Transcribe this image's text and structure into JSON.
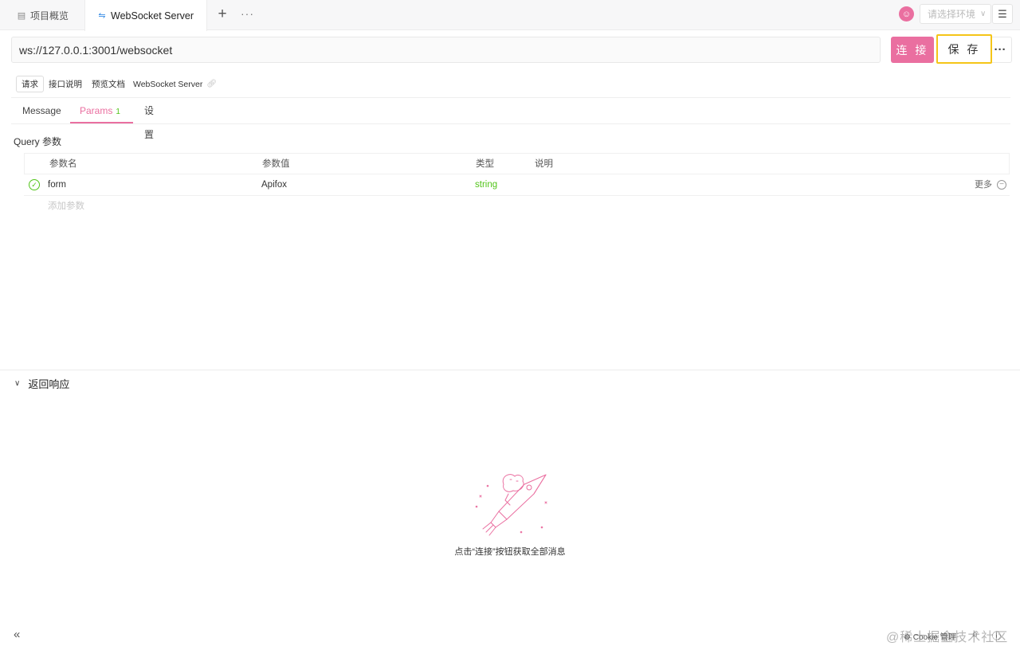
{
  "tabs": {
    "project_overview": "项目概览",
    "websocket_server": "WebSocket Server"
  },
  "header": {
    "env_placeholder": "请选择环境"
  },
  "request": {
    "url": "ws://127.0.0.1:3001/websocket",
    "connect_label": "连 接",
    "save_label": "保 存"
  },
  "doc_tabs": {
    "request": "请求",
    "interface_desc": "接口说明",
    "preview_doc": "预览文档",
    "api_name": "WebSocket Server"
  },
  "sub_tabs": {
    "message": "Message",
    "params": "Params",
    "params_count": "1",
    "settings": "设置"
  },
  "query": {
    "title": "Query 参数",
    "columns": {
      "name": "参数名",
      "value": "参数值",
      "type": "类型",
      "description": "说明"
    },
    "rows": [
      {
        "name": "form",
        "value": "Apifox",
        "type": "string",
        "description": "",
        "more": "更多"
      }
    ],
    "add_placeholder": "添加参数"
  },
  "response": {
    "title": "返回响应",
    "empty_message": "点击“连接”按钮获取全部消息"
  },
  "footer": {
    "cookie": "Cookie 管理",
    "watermark": "@稀土掘金技术社区"
  },
  "colors": {
    "accent": "#ea6fa0",
    "success": "#52c41a",
    "highlight": "#f5c518"
  }
}
